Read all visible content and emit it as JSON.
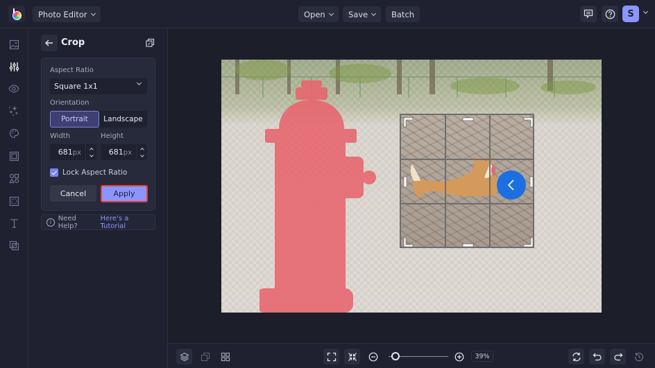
{
  "topbar": {
    "app_menu_label": "Photo Editor",
    "open_label": "Open",
    "save_label": "Save",
    "batch_label": "Batch",
    "avatar_initial": "S"
  },
  "rail": {
    "items": [
      {
        "name": "image",
        "icon": "image-icon",
        "active": false
      },
      {
        "name": "adjust",
        "icon": "sliders-icon",
        "active": true
      },
      {
        "name": "view",
        "icon": "eye-icon",
        "active": false
      },
      {
        "name": "effects",
        "icon": "sparkle-icon",
        "active": false
      },
      {
        "name": "artsy",
        "icon": "palette-icon",
        "active": false
      },
      {
        "name": "frames",
        "icon": "frame-icon",
        "active": false
      },
      {
        "name": "graphics",
        "icon": "shapes-icon",
        "active": false
      },
      {
        "name": "textures",
        "icon": "texture-icon",
        "active": false
      },
      {
        "name": "text",
        "icon": "text-icon",
        "active": false
      },
      {
        "name": "overlay",
        "icon": "overlay-icon",
        "active": false
      }
    ]
  },
  "panel": {
    "title": "Crop",
    "aspect_ratio_label": "Aspect Ratio",
    "aspect_ratio_value": "Square 1x1",
    "orientation_label": "Orientation",
    "orientation_options": [
      "Portrait",
      "Landscape"
    ],
    "orientation_selected": "Portrait",
    "width_label": "Width",
    "height_label": "Height",
    "width_value": "681",
    "height_value": "681",
    "unit": "px",
    "lock_label": "Lock Aspect Ratio",
    "lock_checked": true,
    "cancel_label": "Cancel",
    "apply_label": "Apply",
    "help_text": "Need Help?",
    "help_link": "Here's a Tutorial"
  },
  "bottombar": {
    "zoom_value": "39%",
    "zoom_fraction": 0.12
  },
  "colors": {
    "accent": "#8a95ff",
    "apply_outline": "#e0443f",
    "background": "#1f2130"
  }
}
